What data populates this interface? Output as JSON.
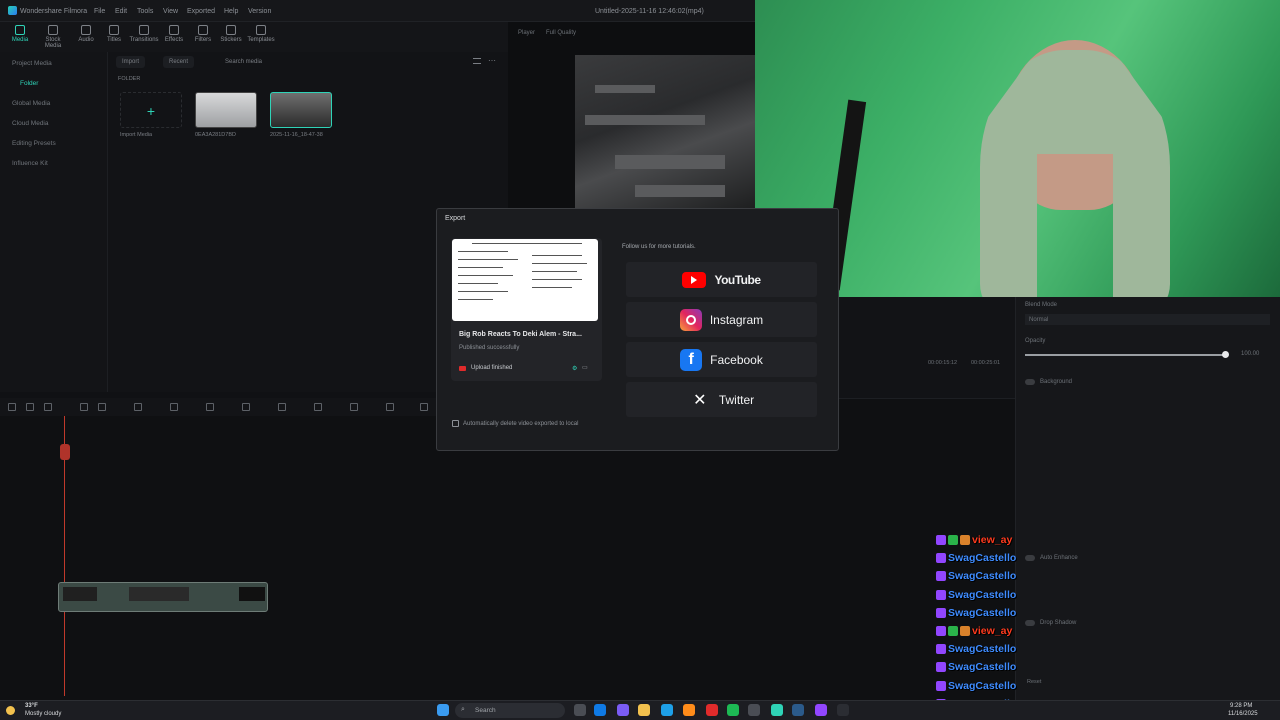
{
  "app": {
    "name": "Wondershare Filmora",
    "menu": [
      "File",
      "Edit",
      "Tools",
      "View",
      "Exported",
      "Help",
      "Version"
    ],
    "doc_title": "Untitled-2025-11-16 12:46:02(mp4)"
  },
  "toolbar": [
    "Media",
    "Stock Media",
    "Audio",
    "Titles",
    "Transitions",
    "Effects",
    "Filters",
    "Stickers",
    "Templates"
  ],
  "sidebar": {
    "items": [
      "Project Media",
      "Folder",
      "Global Media",
      "Cloud Media",
      "Editing Presets",
      "Influence Kit"
    ]
  },
  "media": {
    "import_label": "Import",
    "sort_label": "Recent",
    "search_placeholder": "Search media",
    "folder_label": "FOLDER",
    "import_media": "Import Media",
    "items": [
      {
        "caption": "0EA3A281D7BD"
      },
      {
        "caption": "2025-11-16_18-47-38"
      }
    ]
  },
  "player": {
    "label": "Player",
    "quality": "Full Quality",
    "time_current": "00:00:15:12",
    "time_total": "00:00:25:01"
  },
  "props": {
    "blend_mode_label": "Blend Mode",
    "blend_mode_value": "Normal",
    "opacity_label": "Opacity",
    "opacity_value": "100.00",
    "background_label": "Background",
    "auto_enhance_label": "Auto Enhance",
    "drop_shadow_label": "Drop Shadow",
    "reset_label": "Reset"
  },
  "export": {
    "title": "Export",
    "video_title": "Big Rob Reacts To Deki Alem - Stra...",
    "status": "Published successfully",
    "upload_status": "Upload finished",
    "auto_delete": "Automatically delete video exported to local",
    "follow_text": "Follow us for more tutorials.",
    "socials": [
      {
        "name": "YouTube",
        "icon": "youtube-icon",
        "color": "#ff0000"
      },
      {
        "name": "Instagram",
        "icon": "instagram-icon",
        "color": "#d6249f"
      },
      {
        "name": "Facebook",
        "icon": "facebook-icon",
        "color": "#1877f2"
      },
      {
        "name": "Twitter",
        "icon": "x-twitter-icon",
        "color": "#000000"
      }
    ]
  },
  "chat": [
    {
      "user": "view_ay",
      "color": "#ff3b1f",
      "badges": [
        "twitch",
        "check",
        "sub"
      ]
    },
    {
      "user": "SwagCastello",
      "color": "#3f8cff",
      "badges": [
        "twitch"
      ]
    },
    {
      "user": "SwagCastello",
      "color": "#3f8cff",
      "badges": [
        "twitch"
      ]
    },
    {
      "user": "SwagCastello",
      "color": "#3f8cff",
      "badges": [
        "twitch"
      ]
    },
    {
      "user": "SwagCastello",
      "color": "#3f8cff",
      "badges": [
        "twitch"
      ]
    },
    {
      "user": "view_ay",
      "color": "#ff3b1f",
      "badges": [
        "twitch",
        "check",
        "sub"
      ]
    },
    {
      "user": "SwagCastello",
      "color": "#3f8cff",
      "badges": [
        "twitch"
      ]
    },
    {
      "user": "SwagCastello",
      "color": "#3f8cff",
      "badges": [
        "twitch"
      ]
    },
    {
      "user": "SwagCastello",
      "color": "#3f8cff",
      "badges": [
        "twitch"
      ]
    },
    {
      "user": "SwagCastello",
      "color": "#3f8cff",
      "badges": [
        "twitch"
      ]
    }
  ],
  "taskbar": {
    "weather_temp": "33°F",
    "weather_desc": "Mostly cloudy",
    "search_label": "Search",
    "time": "9:28 PM",
    "date": "11/16/2025"
  }
}
